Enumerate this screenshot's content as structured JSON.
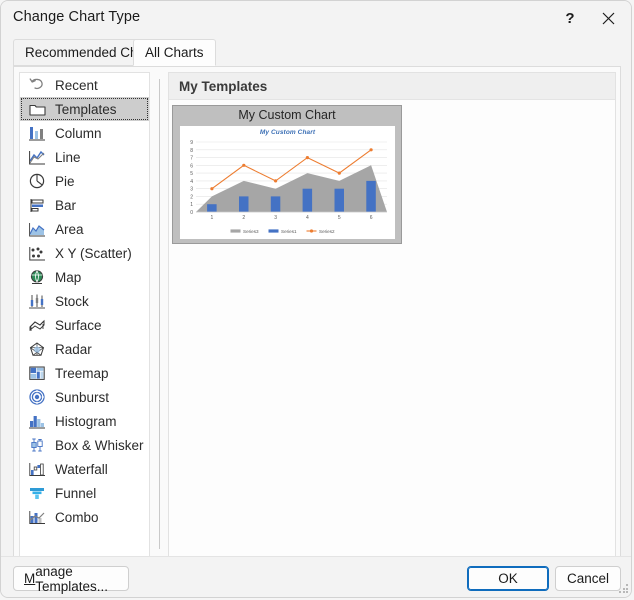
{
  "window": {
    "title": "Change Chart Type",
    "help_icon": "help-question-icon",
    "help_glyph": "?",
    "close_icon": "close-icon"
  },
  "tabs": [
    {
      "label": "Recommended Charts",
      "active": false,
      "name": "tab-recommended-charts"
    },
    {
      "label": "All Charts",
      "active": true,
      "name": "tab-all-charts"
    }
  ],
  "sidebar": {
    "items": [
      {
        "label": "Recent",
        "icon": "recent-history-icon",
        "selected": false
      },
      {
        "label": "Templates",
        "icon": "folder-templates-icon",
        "selected": true
      },
      {
        "label": "Column",
        "icon": "column-chart-icon",
        "selected": false
      },
      {
        "label": "Line",
        "icon": "line-chart-icon",
        "selected": false
      },
      {
        "label": "Pie",
        "icon": "pie-chart-icon",
        "selected": false
      },
      {
        "label": "Bar",
        "icon": "bar-chart-icon",
        "selected": false
      },
      {
        "label": "Area",
        "icon": "area-chart-icon",
        "selected": false
      },
      {
        "label": "X Y (Scatter)",
        "icon": "scatter-chart-icon",
        "selected": false
      },
      {
        "label": "Map",
        "icon": "map-chart-icon",
        "selected": false
      },
      {
        "label": "Stock",
        "icon": "stock-chart-icon",
        "selected": false
      },
      {
        "label": "Surface",
        "icon": "surface-chart-icon",
        "selected": false
      },
      {
        "label": "Radar",
        "icon": "radar-chart-icon",
        "selected": false
      },
      {
        "label": "Treemap",
        "icon": "treemap-chart-icon",
        "selected": false
      },
      {
        "label": "Sunburst",
        "icon": "sunburst-chart-icon",
        "selected": false
      },
      {
        "label": "Histogram",
        "icon": "histogram-chart-icon",
        "selected": false
      },
      {
        "label": "Box & Whisker",
        "icon": "box-whisker-icon",
        "selected": false
      },
      {
        "label": "Waterfall",
        "icon": "waterfall-chart-icon",
        "selected": false
      },
      {
        "label": "Funnel",
        "icon": "funnel-chart-icon",
        "selected": false
      },
      {
        "label": "Combo",
        "icon": "combo-chart-icon",
        "selected": false
      }
    ]
  },
  "gallery": {
    "header": "My Templates",
    "template": {
      "caption": "My Custom Chart"
    }
  },
  "chart_data": {
    "type": "bar",
    "title": "My Custom Chart",
    "xlabel": "",
    "ylabel": "",
    "categories": [
      "1",
      "2",
      "3",
      "4",
      "5",
      "6"
    ],
    "yticks": [
      "0",
      "1",
      "2",
      "3",
      "4",
      "5",
      "6",
      "7",
      "8",
      "9"
    ],
    "ylim": [
      0,
      9
    ],
    "grid": true,
    "legend_position": "bottom",
    "series": [
      {
        "name": "Series3",
        "type": "area",
        "values": [
          2,
          4,
          3,
          5,
          4,
          6
        ],
        "color": "#a6a6a6"
      },
      {
        "name": "Series1",
        "type": "column",
        "values": [
          1,
          2,
          2,
          3,
          3,
          4
        ],
        "color": "#4472c4"
      },
      {
        "name": "Series2",
        "type": "line",
        "values": [
          3,
          6,
          4,
          7,
          5,
          8
        ],
        "color": "#ed7d31"
      }
    ]
  },
  "footer": {
    "manage_prefix": "M",
    "manage_rest": "anage Templates...",
    "ok": "OK",
    "cancel": "Cancel"
  },
  "colors": {
    "accent_blue": "#4472c4",
    "accent_orange": "#ed7d31",
    "accent_gray": "#a6a6a6",
    "title_blue": "#3b6fb5",
    "focus_blue": "#0f6cbd"
  }
}
